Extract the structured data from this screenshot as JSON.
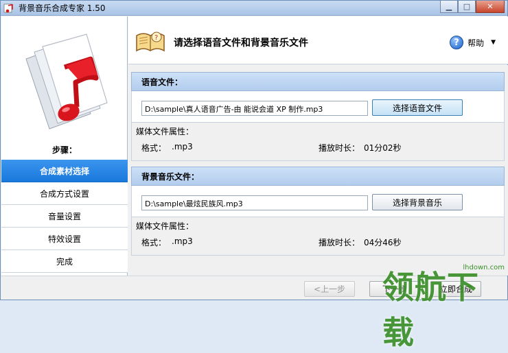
{
  "window": {
    "title": "背景音乐合成专家 1.50"
  },
  "sidebar": {
    "steps_label": "步骤：",
    "items": [
      {
        "label": "合成素材选择",
        "active": true
      },
      {
        "label": "合成方式设置",
        "active": false
      },
      {
        "label": "音量设置",
        "active": false
      },
      {
        "label": "特效设置",
        "active": false
      },
      {
        "label": "完成",
        "active": false
      }
    ]
  },
  "header": {
    "title": "请选择语音文件和背景音乐文件",
    "help_label": "帮助"
  },
  "voice": {
    "heading": "语音文件：",
    "path": "D:\\sample\\真人语音广告-由 能说会道 XP 制作.mp3",
    "button": "选择语音文件",
    "attr_title": "媒体文件属性：",
    "format_label": "格式：",
    "format_value": ".mp3",
    "duration_label": "播放时长：",
    "duration_value": "01分02秒"
  },
  "music": {
    "heading": "背景音乐文件：",
    "path": "D:\\sample\\最炫民族风.mp3",
    "button": "选择背景音乐",
    "attr_title": "媒体文件属性：",
    "format_label": "格式：",
    "format_value": ".mp3",
    "duration_label": "播放时长：",
    "duration_value": "04分46秒"
  },
  "nav": {
    "prev": "<上一步",
    "next": "下一步",
    "merge": "立即合成"
  },
  "watermark": {
    "text": "领航下载",
    "url": "lhdown.com"
  },
  "colors": {
    "accent": "#1a79dd",
    "section_head": "#b3cdee",
    "logo_red": "#d8141d"
  }
}
